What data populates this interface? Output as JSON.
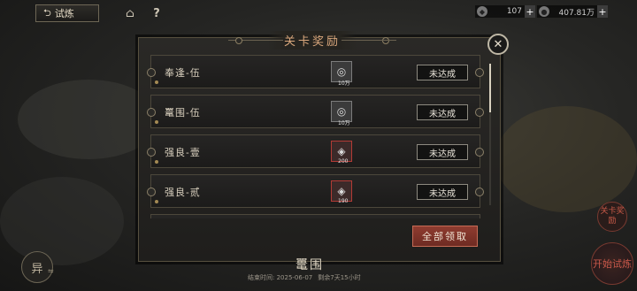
{
  "header": {
    "back_label": "试炼",
    "currencies": [
      {
        "icon": "diamond-icon",
        "value": "107"
      },
      {
        "icon": "coin-icon",
        "value": "407.81万"
      }
    ]
  },
  "dialog": {
    "title": "关卡奖励",
    "rewards": [
      {
        "name": "奉逢-伍",
        "item": "silver-coin-icon",
        "qty": "10万",
        "status": "未达成",
        "frame": "gray"
      },
      {
        "name": "鼍围-伍",
        "item": "silver-coin-icon",
        "qty": "10万",
        "status": "未达成",
        "frame": "gray"
      },
      {
        "name": "强良-壹",
        "item": "crystal-icon",
        "qty": "200",
        "status": "未达成",
        "frame": "red"
      },
      {
        "name": "强良-贰",
        "item": "crystal-icon",
        "qty": "190",
        "status": "未达成",
        "frame": "red"
      }
    ],
    "claim_all_label": "全部领取"
  },
  "side": {
    "reward_label": "关卡奖励",
    "start_label": "开始试炼",
    "switch_label": "异"
  },
  "footer": {
    "stage_title": "鼍围",
    "end_time_label": "结束时间: 2025-06-07",
    "remaining_label": "剩余7天15小时"
  },
  "colors": {
    "accent_red": "#8f3c30",
    "title_gold": "#d9a77c"
  }
}
